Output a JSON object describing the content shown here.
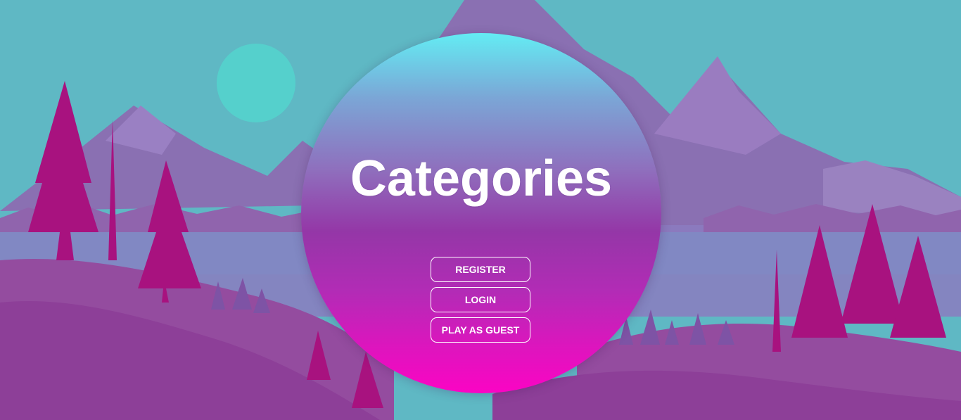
{
  "app": {
    "title": "Categories"
  },
  "menu": {
    "buttons": [
      {
        "id": "register",
        "label": "REGISTER"
      },
      {
        "id": "login",
        "label": "LOGIN"
      },
      {
        "id": "guest",
        "label": "PLAY AS GUEST"
      }
    ]
  },
  "theme": {
    "sky": "#5fb8c4",
    "sun": "#55d0cc",
    "mountain": "#8a70b2",
    "tree": "#a8127f",
    "ground": "#944c9f",
    "gradient_top": "#63ecf3",
    "gradient_bottom": "#fb04c4",
    "text": "#ffffff"
  }
}
